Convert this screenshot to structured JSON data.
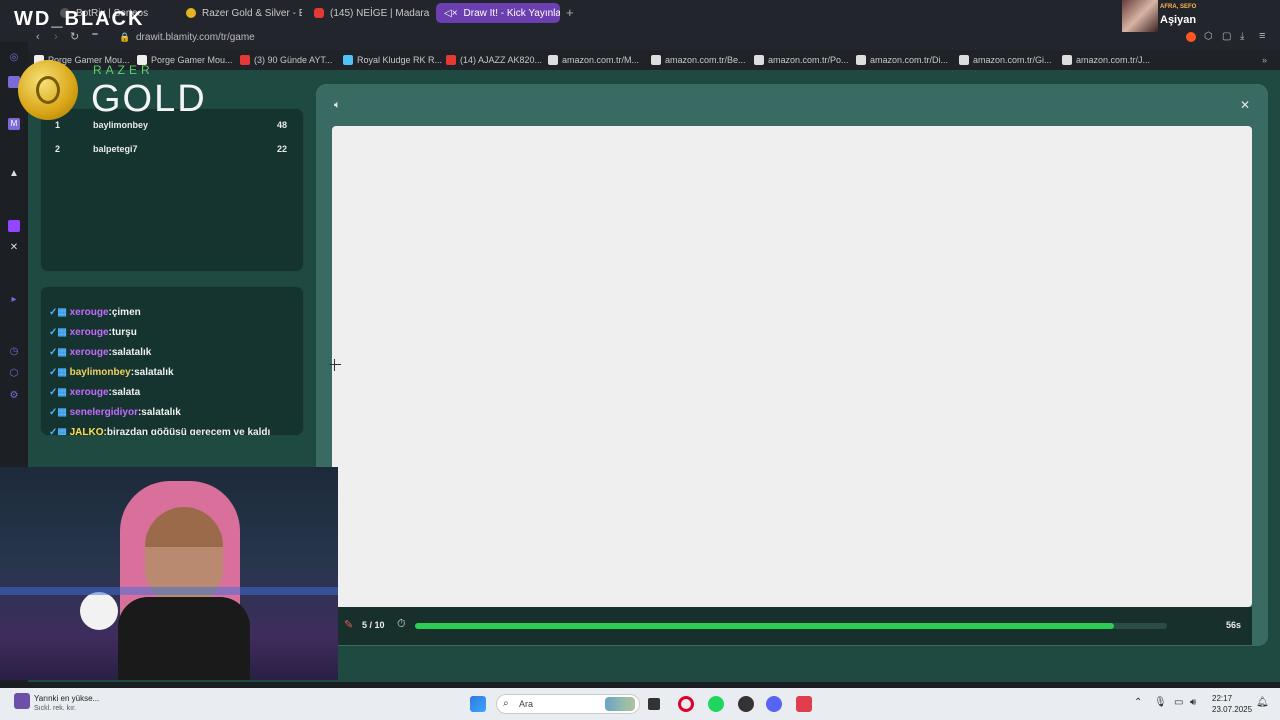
{
  "browser": {
    "tabs": [
      {
        "label": "BotRix | Sorteos"
      },
      {
        "label": "Razer Gold & Silver - En L"
      },
      {
        "label": "(145) NEİGE | Madara Old"
      },
      {
        "label": "Draw It! - Kick Yayınla"
      }
    ],
    "url": "drawit.blamity.com/tr/game",
    "vpn": "VPN",
    "bookmarks": [
      "Porge Gamer Mou...",
      "Porge Gamer Mou...",
      "(3) 90 Günde AYT...",
      "Royal Kludge RK R...",
      "(14) AJAZZ AK820...",
      "amazon.com.tr/M...",
      "amazon.com.tr/Be...",
      "amazon.com.tr/Po...",
      "amazon.com.tr/Di...",
      "amazon.com.tr/Gi...",
      "amazon.com.tr/J..."
    ]
  },
  "overlay": {
    "wd_black": "WD_BLACK",
    "razer": "RAZER",
    "gold": "GOLD",
    "streamer_small": "AFRA, SEFO",
    "streamer": "Aşiyan"
  },
  "leaderboard": [
    {
      "rank": "1",
      "name": "baylimonbey",
      "score": "48"
    },
    {
      "rank": "2",
      "name": "balpetegi7",
      "score": "22"
    }
  ],
  "chat": [
    {
      "user": "xerouge",
      "msg": ":çimen",
      "color": "#c36bff"
    },
    {
      "user": "xerouge",
      "msg": ":turşu",
      "color": "#c36bff"
    },
    {
      "user": "xerouge",
      "msg": ":salatalık",
      "color": "#c36bff"
    },
    {
      "user": "baylimonbey",
      "msg": ":salatalık",
      "color": "#f0d060"
    },
    {
      "user": "xerouge",
      "msg": ":salata",
      "color": "#c36bff"
    },
    {
      "user": "senelergidiyor",
      "msg": ":salatalık",
      "color": "#c36bff"
    },
    {
      "user": "JALKO",
      "msg": ":birazdan göğüsü gerecem ve kaldı",
      "color": "#ffe14d"
    }
  ],
  "game": {
    "round": "5 / 10",
    "timer": "56s",
    "progress": 0.93,
    "accent": "#2ecc55"
  },
  "taskbar": {
    "weather_title": "Yarınki en yükse...",
    "weather_sub": "Sıckl. rek. kır.",
    "search": "Ara",
    "time": "22:17",
    "date": "23.07.2025"
  }
}
